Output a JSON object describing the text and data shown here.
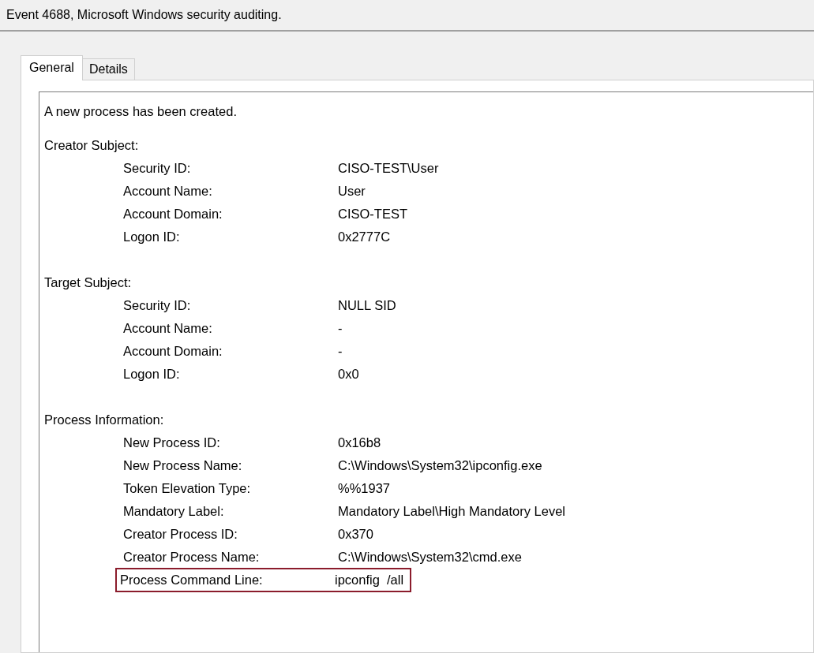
{
  "window": {
    "title": "Event 4688, Microsoft Windows security auditing."
  },
  "tabs": [
    {
      "label": "General",
      "selected": true
    },
    {
      "label": "Details",
      "selected": false
    }
  ],
  "message": "A new process has been created.",
  "sections": [
    {
      "heading": "Creator Subject:",
      "fields": [
        {
          "label": "Security ID:",
          "value": "CISO-TEST\\User",
          "highlighted": false
        },
        {
          "label": "Account Name:",
          "value": "User",
          "highlighted": false
        },
        {
          "label": "Account Domain:",
          "value": "CISO-TEST",
          "highlighted": false
        },
        {
          "label": "Logon ID:",
          "value": "0x2777C",
          "highlighted": false
        }
      ]
    },
    {
      "heading": "Target Subject:",
      "fields": [
        {
          "label": "Security ID:",
          "value": "NULL SID",
          "highlighted": false
        },
        {
          "label": "Account Name:",
          "value": "-",
          "highlighted": false
        },
        {
          "label": "Account Domain:",
          "value": "-",
          "highlighted": false
        },
        {
          "label": "Logon ID:",
          "value": "0x0",
          "highlighted": false
        }
      ]
    },
    {
      "heading": "Process Information:",
      "fields": [
        {
          "label": "New Process ID:",
          "value": "0x16b8",
          "highlighted": false
        },
        {
          "label": "New Process Name:",
          "value": "C:\\Windows\\System32\\ipconfig.exe",
          "highlighted": false
        },
        {
          "label": "Token Elevation Type:",
          "value": "%%1937",
          "highlighted": false
        },
        {
          "label": "Mandatory Label:",
          "value": "Mandatory Label\\High Mandatory Level",
          "highlighted": false
        },
        {
          "label": "Creator Process ID:",
          "value": "0x370",
          "highlighted": false
        },
        {
          "label": "Creator Process Name:",
          "value": "C:\\Windows\\System32\\cmd.exe",
          "highlighted": false
        },
        {
          "label": "Process Command Line:",
          "value": "ipconfig  /all",
          "highlighted": true
        }
      ]
    }
  ]
}
